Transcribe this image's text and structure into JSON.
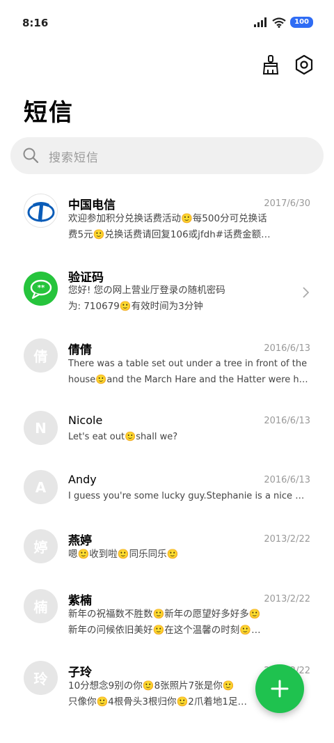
{
  "status": {
    "time": "8:16",
    "battery": "100"
  },
  "title": "短信",
  "search": {
    "placeholder": "搜索短信"
  },
  "conversations": [
    {
      "name": "中国电信",
      "date": "2017/6/30",
      "line1": "欢迎参加积分兑换话费活动🙂每500分可兑换话",
      "line2": "费5元🙂兑换话费请回复106或jfdh#话费金额…",
      "avatar": "telecom-logo"
    },
    {
      "name": "验证码",
      "date": "",
      "line1": "您好! 您の网上营业厅登录の随机密码",
      "line2": "为: 710679🙂有效时间为3分钟",
      "avatar": "sms-bubble"
    },
    {
      "name": "倩倩",
      "date": "2016/6/13",
      "line1": "There was a table set out under a tree in front of the",
      "line2": "house🙂and the March Hare and the Hatter were havin…",
      "avatar_letter": "倩"
    },
    {
      "name": "Nicole",
      "date": "2016/6/13",
      "line1": "Let's eat out🙂shall we?",
      "line2": "",
      "avatar_letter": "N"
    },
    {
      "name": "Andy",
      "date": "2016/6/13",
      "line1": "I guess you're some lucky guy.Stephanie is a nice girl.",
      "line2": "",
      "avatar_letter": "A"
    },
    {
      "name": "燕婷",
      "date": "2013/2/22",
      "line1": "嗯🙂收到啦🙂同乐同乐🙂",
      "line2": "",
      "avatar_letter": "婷"
    },
    {
      "name": "紫楠",
      "date": "2013/2/22",
      "line1": "新年の祝福数不胜数🙂新年の愿望好多好多🙂",
      "line2": "新年の问候依旧美好🙂在这个温馨の时刻🙂…",
      "avatar_letter": "楠"
    },
    {
      "name": "子玲",
      "date": "2013/2/22",
      "line1": "10分想念9别の你🙂8张照片7张是你🙂",
      "line2": "只像你🙂4根骨头3根归你🙂2爪着地1足…",
      "avatar_letter": "玲"
    }
  ],
  "colors": {
    "accent": "#1fc24f",
    "battery": "#2f6cf4",
    "telecom": "#0a5cb8"
  },
  "icons": [
    "clean-brush-icon",
    "settings-icon",
    "search-icon",
    "chevron-right-icon",
    "add-icon"
  ]
}
